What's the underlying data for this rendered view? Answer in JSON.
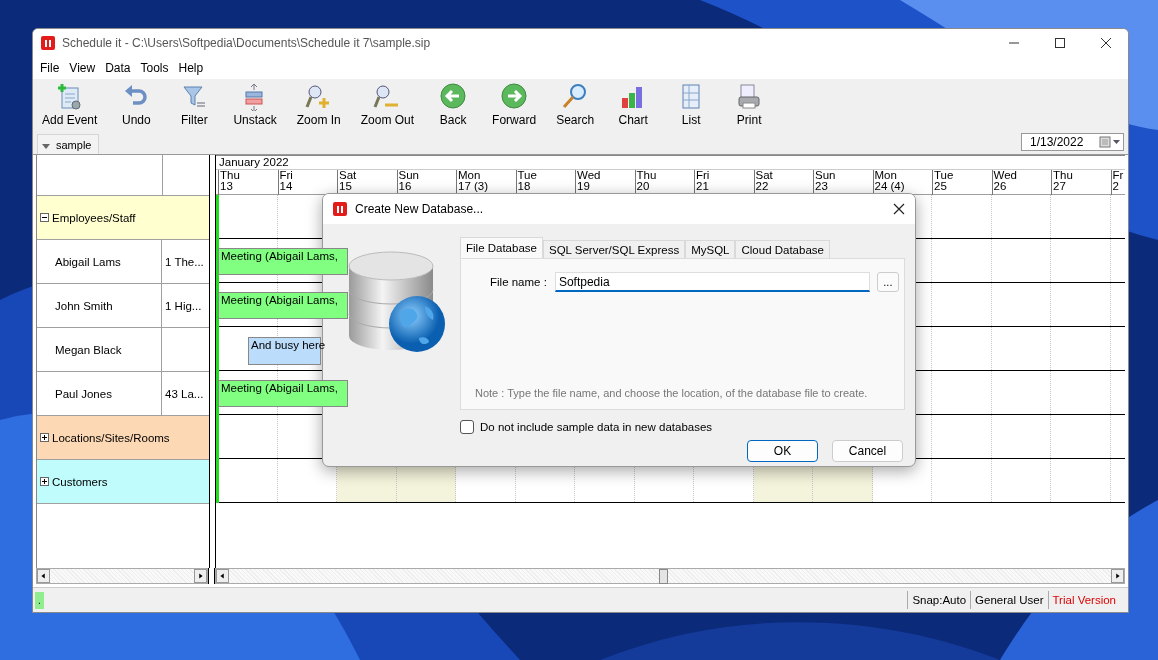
{
  "window": {
    "title": "Schedule it - C:\\Users\\Softpedia\\Documents\\Schedule it 7\\sample.sip"
  },
  "menu": [
    "File",
    "View",
    "Data",
    "Tools",
    "Help"
  ],
  "toolbar": [
    {
      "label": "Add Event"
    },
    {
      "label": "Undo"
    },
    {
      "label": "Filter"
    },
    {
      "label": "Unstack"
    },
    {
      "label": "Zoom In"
    },
    {
      "label": "Zoom Out"
    },
    {
      "label": "Back"
    },
    {
      "label": "Forward"
    },
    {
      "label": "Search"
    },
    {
      "label": "Chart"
    },
    {
      "label": "List"
    },
    {
      "label": "Print"
    }
  ],
  "view_tab": {
    "label": "sample"
  },
  "date_picker": {
    "value": "1/13/2022"
  },
  "timeline": {
    "month": "January 2022",
    "days": [
      {
        "weekday": "Thu",
        "day": "13",
        "weekend": false
      },
      {
        "weekday": "Fri",
        "day": "14",
        "weekend": false
      },
      {
        "weekday": "Sat",
        "day": "15",
        "weekend": true
      },
      {
        "weekday": "Sun",
        "day": "16",
        "weekend": true
      },
      {
        "weekday": "Mon",
        "day": "17 (3)",
        "weekend": false
      },
      {
        "weekday": "Tue",
        "day": "18",
        "weekend": false
      },
      {
        "weekday": "Wed",
        "day": "19",
        "weekend": false
      },
      {
        "weekday": "Thu",
        "day": "20",
        "weekend": false
      },
      {
        "weekday": "Fri",
        "day": "21",
        "weekend": false
      },
      {
        "weekday": "Sat",
        "day": "22",
        "weekend": true
      },
      {
        "weekday": "Sun",
        "day": "23",
        "weekend": true
      },
      {
        "weekday": "Mon",
        "day": "24 (4)",
        "weekend": false
      },
      {
        "weekday": "Tue",
        "day": "25",
        "weekend": false
      },
      {
        "weekday": "Wed",
        "day": "26",
        "weekend": false
      },
      {
        "weekday": "Thu",
        "day": "27",
        "weekend": false
      },
      {
        "weekday": "Fr",
        "day": "2",
        "weekend": false
      }
    ]
  },
  "resources": [
    {
      "name": "Employees/Staff",
      "expanded": true,
      "color": "#ffffd0",
      "children": [
        {
          "name": "Abigail Lams",
          "address": "1 The...",
          "events": [
            {
              "kind": "meeting",
              "text": "Meeting (Abigail Lams,"
            }
          ]
        },
        {
          "name": "John Smith",
          "address": "1 Hig...",
          "events": [
            {
              "kind": "meeting",
              "text": "Meeting (Abigail Lams,"
            }
          ]
        },
        {
          "name": "Megan Black",
          "events": [
            {
              "kind": "busy",
              "text": "And busy here"
            }
          ]
        },
        {
          "name": "Paul Jones",
          "address": "43 La...",
          "events": [
            {
              "kind": "meeting",
              "text": "Meeting (Abigail Lams,"
            }
          ]
        }
      ]
    },
    {
      "name": "Locations/Sites/Rooms",
      "expanded": false,
      "color": "#fcd9b4"
    },
    {
      "name": "Customers",
      "expanded": false,
      "color": "#c0fcfc"
    }
  ],
  "status_bar": [
    {
      "kind": "indicator",
      "text": "."
    },
    {
      "kind": "normal",
      "text": "Snap:Auto"
    },
    {
      "kind": "normal",
      "text": "General User"
    },
    {
      "kind": "warning",
      "text": "Trial Version"
    }
  ],
  "dialog": {
    "title": "Create New Database...",
    "tabs": [
      {
        "label": "File Database",
        "selected": true
      },
      {
        "label": "SQL Server/SQL Express",
        "selected": false
      },
      {
        "label": "MySQL",
        "selected": false
      },
      {
        "label": "Cloud Database",
        "selected": false
      }
    ],
    "file_name": {
      "label": "File name :",
      "value": "Softpedia"
    },
    "browse": "...",
    "note": "Note : Type the file name, and choose the location, of the database file to create.",
    "checkbox": {
      "label": "Do not include sample data in new databases",
      "checked": false
    },
    "buttons": [
      {
        "label": "OK",
        "default": true
      },
      {
        "label": "Cancel",
        "default": false
      }
    ]
  }
}
